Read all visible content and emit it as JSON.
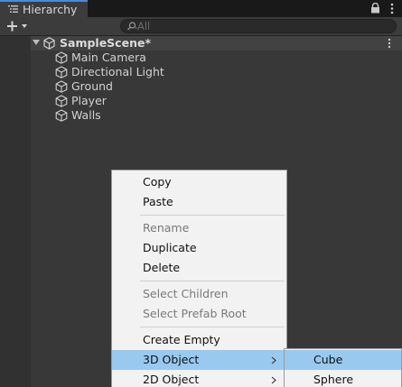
{
  "tab": {
    "title": "Hierarchy",
    "icon": "list-icon",
    "lock_icon": "lock-icon",
    "menu_icon": "kebab-menu-icon"
  },
  "toolbar": {
    "add_icon": "plus-dropdown-icon",
    "search_icon": "search-icon",
    "search_placeholder": "All",
    "search_value": ""
  },
  "scene": {
    "name": "SampleScene*",
    "icon": "unity-scene-icon",
    "expanded": true
  },
  "objects": [
    {
      "label": "Main Camera",
      "icon": "gameobject-cube-icon"
    },
    {
      "label": "Directional Light",
      "icon": "gameobject-cube-icon"
    },
    {
      "label": "Ground",
      "icon": "gameobject-cube-icon"
    },
    {
      "label": "Player",
      "icon": "gameobject-cube-icon"
    },
    {
      "label": "Walls",
      "icon": "gameobject-cube-icon"
    }
  ],
  "context_menu": {
    "items": [
      {
        "label": "Copy",
        "enabled": true
      },
      {
        "label": "Paste",
        "enabled": true
      },
      {
        "label": "Rename",
        "enabled": false
      },
      {
        "label": "Duplicate",
        "enabled": true
      },
      {
        "label": "Delete",
        "enabled": true
      },
      {
        "label": "Select Children",
        "enabled": false
      },
      {
        "label": "Select Prefab Root",
        "enabled": false
      },
      {
        "label": "Create Empty",
        "enabled": true
      },
      {
        "label": "3D Object",
        "enabled": true,
        "submenu": true,
        "highlighted": true
      },
      {
        "label": "2D Object",
        "enabled": true,
        "submenu": true
      }
    ]
  },
  "submenu": {
    "items": [
      {
        "label": "Cube",
        "highlighted": true
      },
      {
        "label": "Sphere"
      }
    ]
  },
  "colors": {
    "accent": "#4d88d6",
    "menu_highlight": "#99c9ef",
    "panel_bg": "#383838"
  }
}
